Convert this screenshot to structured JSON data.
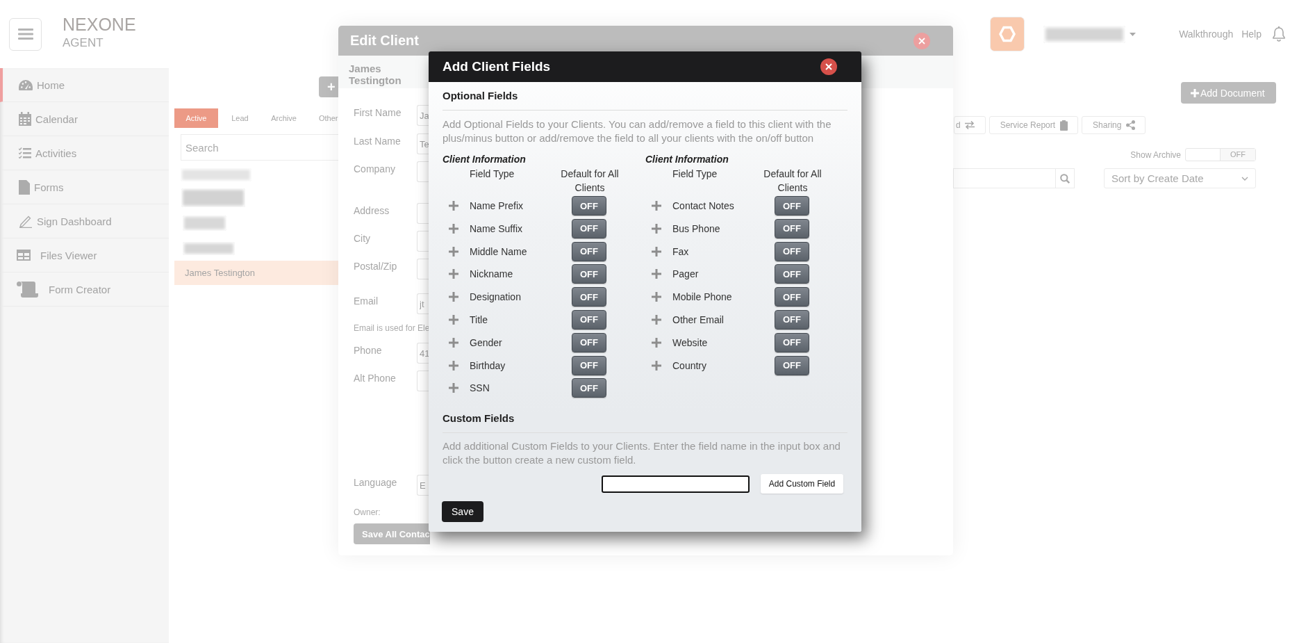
{
  "header": {
    "logo": "NEXONE",
    "logo_subtitle": "AGENT",
    "links": [
      "Walkthrough",
      "Help"
    ]
  },
  "sidebar": {
    "items": [
      {
        "label": "Home",
        "selected": true
      },
      {
        "label": "Calendar",
        "selected": false
      },
      {
        "label": "Activities",
        "selected": false
      },
      {
        "label": "Forms",
        "selected": false
      },
      {
        "label": "Sign Dashboard",
        "selected": false
      },
      {
        "label": "Files Viewer",
        "selected": false
      },
      {
        "label": "Form Creator",
        "selected": false
      }
    ]
  },
  "client_list": {
    "add_button": "+",
    "tabs": [
      {
        "label": "Active",
        "selected": true
      },
      {
        "label": "Lead",
        "selected": false
      },
      {
        "label": "Archive",
        "selected": false
      },
      {
        "label": "Other",
        "selected": false
      }
    ],
    "search": {
      "placeholder": "Search"
    },
    "rows": [
      {
        "kind": "blurred",
        "selected": false
      },
      {
        "kind": "blurred",
        "selected": false
      },
      {
        "kind": "blurred",
        "selected": false
      },
      {
        "kind": "blurred",
        "selected": false
      },
      {
        "kind": "name",
        "name": "James Testington",
        "selected": true
      }
    ]
  },
  "documents": {
    "add_button": "Add Document",
    "toolbar": [
      {
        "label": "d"
      },
      {
        "label": "Service Report"
      },
      {
        "label": "Sharing"
      }
    ],
    "show_archive": {
      "label": "Show Archive",
      "toggle": "OFF",
      "on": false
    },
    "sort": "Sort by Create Date"
  },
  "edit_client": {
    "title": "Edit Client",
    "client_name": "James Testington",
    "fields": [
      {
        "kind": "input",
        "label": "First Name",
        "value": "Ja"
      },
      {
        "kind": "input",
        "label": "Last Name",
        "value": "Te"
      },
      {
        "kind": "input",
        "label": "Company"
      },
      {
        "kind": "input",
        "label": "Address"
      },
      {
        "kind": "input",
        "label": "City"
      },
      {
        "kind": "input",
        "label": "Postal/Zip"
      },
      {
        "kind": "input",
        "label": "Email",
        "value": "jt"
      },
      {
        "kind": "note",
        "text": "Email is used for Ele"
      },
      {
        "kind": "input",
        "label": "Phone",
        "value": "41"
      },
      {
        "kind": "input",
        "label": "Alt Phone"
      },
      {
        "kind": "input",
        "label": "Language",
        "value": "E"
      },
      {
        "kind": "label",
        "text": "Owner:"
      }
    ],
    "save_button": "Save All Contac"
  },
  "add_client_fields": {
    "title": "Add Client Fields",
    "optional": {
      "heading": "Optional Fields",
      "description": "Add Optional Fields to your Clients. You can add/remove a field to this client with the plus/minus button or add/remove the field to all your clients with the on/off button",
      "columns": [
        {
          "heading": "Client Information",
          "field_type_header": "Field Type",
          "default_header": "Default for All Clients",
          "fields": [
            {
              "label": "Name Prefix",
              "toggle": "OFF",
              "on": false
            },
            {
              "label": "Name Suffix",
              "toggle": "OFF",
              "on": false
            },
            {
              "label": "Middle Name",
              "toggle": "OFF",
              "on": false
            },
            {
              "label": "Nickname",
              "toggle": "OFF",
              "on": false
            },
            {
              "label": "Designation",
              "toggle": "OFF",
              "on": false
            },
            {
              "label": "Title",
              "toggle": "OFF",
              "on": false
            },
            {
              "label": "Gender",
              "toggle": "OFF",
              "on": false
            },
            {
              "label": "Birthday",
              "toggle": "OFF",
              "on": false
            },
            {
              "label": "SSN",
              "toggle": "OFF",
              "on": false
            }
          ]
        },
        {
          "heading": "Client Information",
          "field_type_header": "Field Type",
          "default_header": "Default for All Clients",
          "fields": [
            {
              "label": "Contact Notes",
              "toggle": "OFF",
              "on": false
            },
            {
              "label": "Bus Phone",
              "toggle": "OFF",
              "on": false
            },
            {
              "label": "Fax",
              "toggle": "OFF",
              "on": false
            },
            {
              "label": "Pager",
              "toggle": "OFF",
              "on": false
            },
            {
              "label": "Mobile Phone",
              "toggle": "OFF",
              "on": false
            },
            {
              "label": "Other Email",
              "toggle": "OFF",
              "on": false
            },
            {
              "label": "Website",
              "toggle": "OFF",
              "on": false
            },
            {
              "label": "Country",
              "toggle": "OFF",
              "on": false
            }
          ]
        }
      ]
    },
    "custom": {
      "heading": "Custom Fields",
      "description": "Add additional Custom Fields to your Clients. Enter the field name in the input box and click the button create a new custom field.",
      "button": "Add Custom Field"
    },
    "save_button": "Save"
  }
}
